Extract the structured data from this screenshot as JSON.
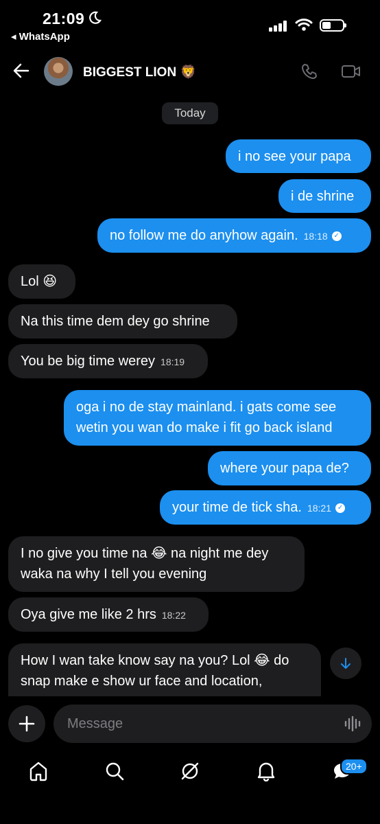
{
  "status_bar": {
    "time": "21:09",
    "back_app": "◂ WhatsApp"
  },
  "header": {
    "contact_name": "BIGGEST LION 🦁"
  },
  "date_chip": "Today",
  "messages": [
    {
      "dir": "out",
      "text": "i no see your papa"
    },
    {
      "dir": "out",
      "text": "i de shrine"
    },
    {
      "dir": "out",
      "text": "no follow me do anyhow again.",
      "time": "18:18"
    },
    {
      "dir": "in",
      "text": "Lol 😆"
    },
    {
      "dir": "in",
      "text": "Na this time dem dey go shrine"
    },
    {
      "dir": "in",
      "text": "You be big time werey",
      "time": "18:19"
    },
    {
      "dir": "out",
      "text": "oga i no de stay mainland. i gats come see wetin you wan do make i fit go back island"
    },
    {
      "dir": "out",
      "text": "where your papa de?"
    },
    {
      "dir": "out",
      "text": "your time de tick sha.",
      "time": "18:21"
    },
    {
      "dir": "in",
      "text": "I no give you time na 😂 na night me dey waka  na why I tell you evening"
    },
    {
      "dir": "in",
      "text": "Oya give me like 2 hrs",
      "time": "18:22"
    },
    {
      "dir": "in",
      "text": "How I wan take know say na you? Lol 😂 do snap make e show ur face and location,"
    }
  ],
  "compose": {
    "placeholder": "Message"
  },
  "bottom_nav": {
    "notifications_badge": "20+"
  },
  "colors": {
    "outgoing": "#1c8fef",
    "incoming": "#1e1e20",
    "background": "#000000"
  }
}
